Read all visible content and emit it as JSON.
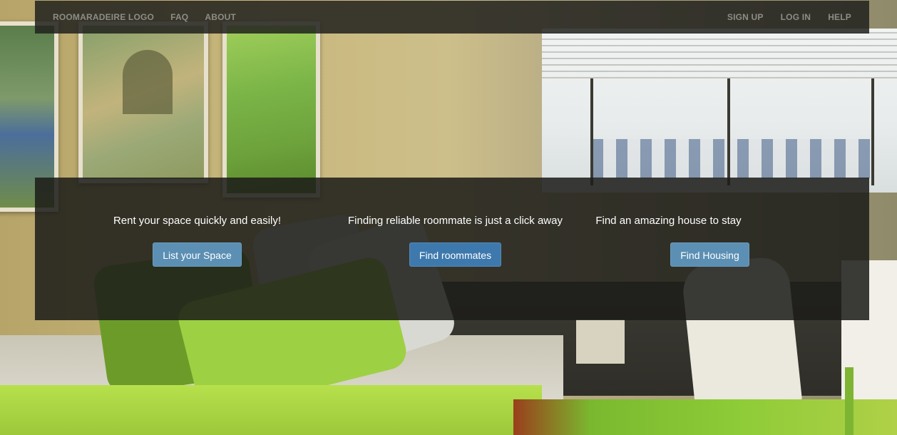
{
  "nav": {
    "left_items": [
      {
        "label": "ROOMARADEIRE LOGO"
      },
      {
        "label": "FAQ"
      },
      {
        "label": "ABOUT"
      }
    ],
    "right_items": [
      {
        "label": "SIGN UP"
      },
      {
        "label": "LOG IN"
      },
      {
        "label": "HELP"
      }
    ]
  },
  "hero": {
    "columns": [
      {
        "text": "Rent your space quickly and easily!",
        "button": "List your Space"
      },
      {
        "text": "Finding reliable roommate is just a click away",
        "button": "Find roommates"
      },
      {
        "text": "Find an amazing house to stay",
        "button": "Find Housing"
      }
    ]
  },
  "colors": {
    "button_primary": "#5b8fb3",
    "button_active": "#3e79ad",
    "overlay": "#1c1c18"
  }
}
